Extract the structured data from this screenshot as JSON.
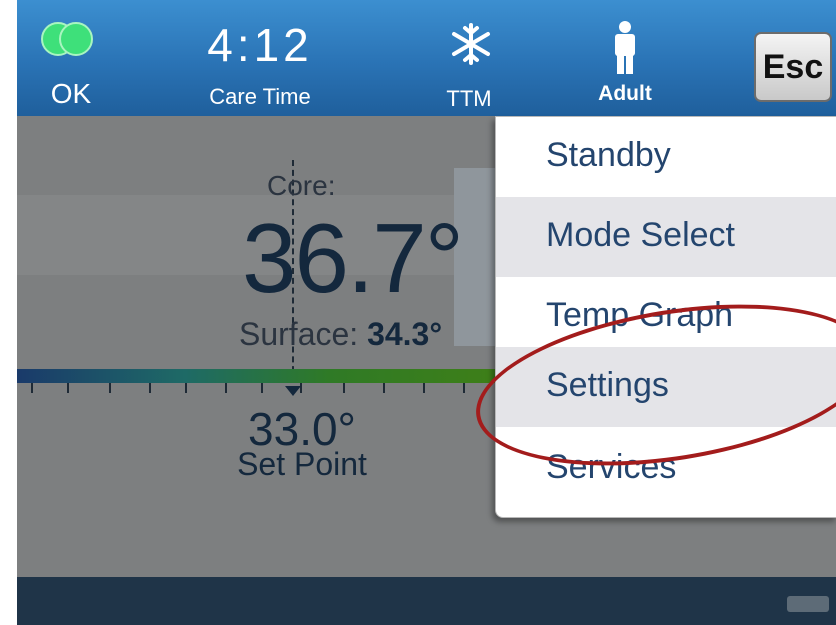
{
  "header": {
    "status_label": "OK",
    "clock": "4:12",
    "clock_label": "Care Time",
    "therapy_label": "TTM",
    "patient_label": "Adult",
    "esc_label": "Esc"
  },
  "main": {
    "core_label": "Core:",
    "core_value": "36.7°",
    "surface_label": "Surface:",
    "surface_value": "34.3°",
    "setpoint_value": "33.0°",
    "setpoint_label": "Set Point"
  },
  "menu": {
    "items": [
      {
        "label": "Standby"
      },
      {
        "label": "Mode Select"
      },
      {
        "label": "Temp Graph"
      },
      {
        "label": "Settings"
      },
      {
        "label": "Services"
      }
    ]
  },
  "icons": {
    "status": "status-ok-icon",
    "therapy": "snowflake-icon",
    "patient": "person-icon",
    "battery": "battery-icon"
  },
  "colors": {
    "header": "#2a73b5",
    "status_ok": "#3ee07a",
    "menu_text": "#24456e",
    "annotation": "#a31c1c"
  }
}
